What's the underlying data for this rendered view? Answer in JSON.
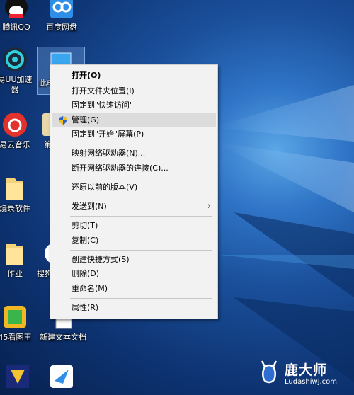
{
  "desktop_icons": [
    {
      "id": "qq",
      "label": "腾讯QQ"
    },
    {
      "id": "baidu",
      "label": "百度网盘"
    },
    {
      "id": "uu",
      "label_line1": "易UU加速",
      "label_line2": "器"
    },
    {
      "id": "pc",
      "label": "此电"
    },
    {
      "id": "music",
      "label": "易云音乐"
    },
    {
      "id": "partial1",
      "label": "第"
    },
    {
      "id": "folder1",
      "label": "烧录软件"
    },
    {
      "id": "folder2",
      "label": "作业"
    },
    {
      "id": "sogou",
      "label": "搜狗"
    },
    {
      "id": "kantu",
      "label": "45看图王"
    },
    {
      "id": "txt",
      "label": "新建文本文档"
    }
  ],
  "context_menu": {
    "items": [
      {
        "label": "打开(O)"
      },
      {
        "label": "打开文件夹位置(I)"
      },
      {
        "label": "固定到\"快速访问\""
      },
      {
        "label": "管理(G)"
      },
      {
        "label": "固定到\"开始\"屏幕(P)"
      },
      {
        "label": "映射网络驱动器(N)..."
      },
      {
        "label": "断开网络驱动器的连接(C)..."
      },
      {
        "label": "还原以前的版本(V)"
      },
      {
        "label": "发送到(N)"
      },
      {
        "label": "剪切(T)"
      },
      {
        "label": "复制(C)"
      },
      {
        "label": "创建快捷方式(S)"
      },
      {
        "label": "删除(D)"
      },
      {
        "label": "重命名(M)"
      },
      {
        "label": "属性(R)"
      }
    ]
  },
  "watermark": {
    "title": "鹿大师",
    "url": "Ludashiwj.com"
  },
  "icons": {
    "shield": "uac-shield-icon",
    "submenu": "chevron-right-icon"
  }
}
